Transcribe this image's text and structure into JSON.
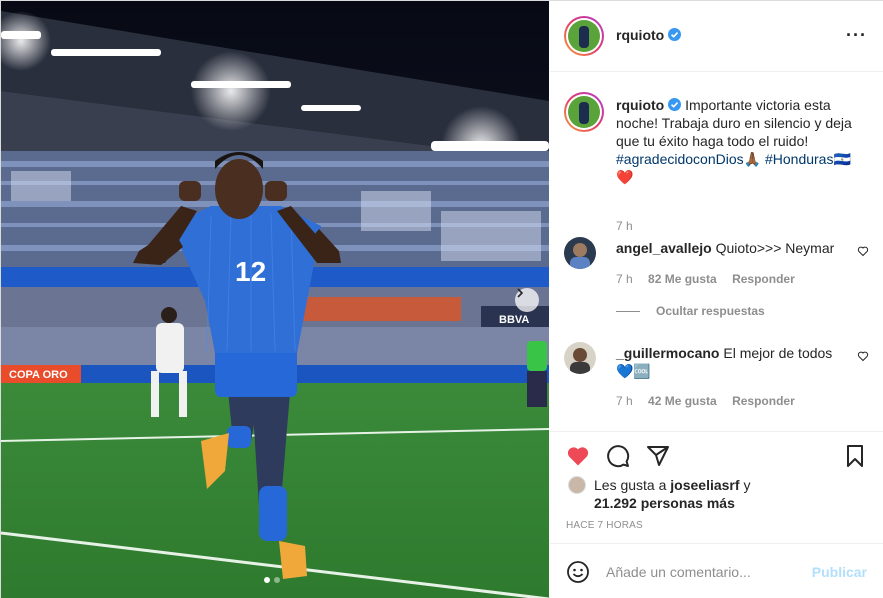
{
  "post": {
    "username": "rquioto",
    "caption_text": "Importante victoria esta noche! Trabaja duro en silencio y deja que tu éxito haga todo el ruido!",
    "hashtag_1": "#agradecidoconDios🙏🏾",
    "hashtag_2": "#Honduras🇸🇻",
    "caption_emoji": "❤️",
    "caption_time": "7 h",
    "photo": {
      "jersey_number": "12",
      "board_text": "COPA ORO",
      "sign_text": "BBVA",
      "active_slide": 1,
      "total_slides": 2
    }
  },
  "comments": [
    {
      "username": "angel_avallejo",
      "text": "Quioto>>> Neymar",
      "time": "7 h",
      "likes": "82 Me gusta",
      "reply": "Responder"
    },
    {
      "username": "_guillermocano",
      "text": "El mejor de todos",
      "emoji": "💙🆒",
      "time": "7 h",
      "likes": "42 Me gusta",
      "reply": "Responder"
    }
  ],
  "hide_replies": "Ocultar respuestas",
  "likes_summary": {
    "prefix": "Les gusta a",
    "user": "joseeliasrf",
    "joiner": "y",
    "count": "21.292 personas más"
  },
  "posted": "HACE 7 HORAS",
  "composer": {
    "placeholder": "Añade un comentario...",
    "publish": "Publicar"
  },
  "colors": {
    "like_red": "#ed4956",
    "verified_blue": "#3897f0",
    "publish_disabled": "#b2dffc",
    "honduras_blue": "#2f6fd6"
  },
  "icons": [
    "more-icon",
    "verified-icon",
    "heart-icon",
    "comment-icon",
    "share-icon",
    "bookmark-icon",
    "emoji-icon",
    "chevron-right-icon"
  ]
}
